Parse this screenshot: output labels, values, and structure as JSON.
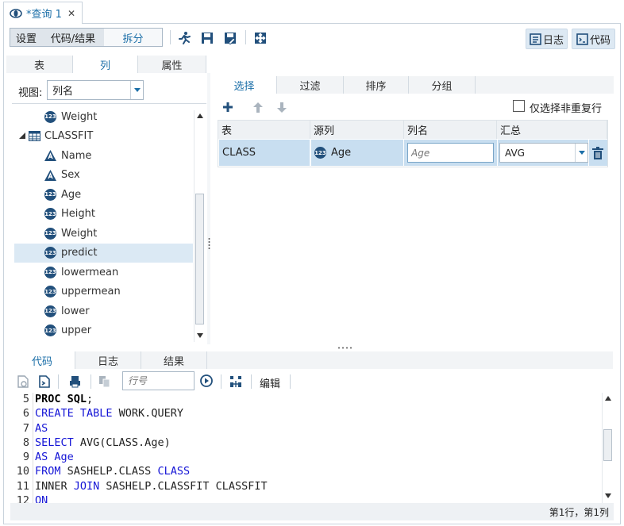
{
  "document_tab": {
    "title": "*查询 1",
    "close": "✕"
  },
  "toolbar": {
    "segments": [
      "设置",
      "代码/结果",
      "拆分"
    ],
    "log_button": "日志",
    "code_button": "代码"
  },
  "left_tabs": [
    "表",
    "列",
    "属性"
  ],
  "view": {
    "label": "视图:",
    "value": "列名"
  },
  "tree": {
    "items": [
      {
        "label": "Weight",
        "type": "numeric"
      },
      {
        "label": "CLASSFIT",
        "type": "table"
      },
      {
        "label": "Name",
        "type": "char"
      },
      {
        "label": "Sex",
        "type": "char"
      },
      {
        "label": "Age",
        "type": "numeric"
      },
      {
        "label": "Height",
        "type": "numeric"
      },
      {
        "label": "Weight",
        "type": "numeric"
      },
      {
        "label": "predict",
        "type": "numeric",
        "selected": true
      },
      {
        "label": "lowermean",
        "type": "numeric"
      },
      {
        "label": "uppermean",
        "type": "numeric"
      },
      {
        "label": "lower",
        "type": "numeric"
      },
      {
        "label": "upper",
        "type": "numeric"
      }
    ]
  },
  "right_tabs": [
    "选择",
    "过滤",
    "排序",
    "分组"
  ],
  "distinct_label": "仅选择非重复行",
  "grid": {
    "headers": [
      "表",
      "源列",
      "列名",
      "汇总"
    ],
    "row": {
      "table": "CLASS",
      "source": "Age",
      "name_placeholder": "Age",
      "summary": "AVG"
    }
  },
  "bottom_tabs": [
    "代码",
    "日志",
    "结果"
  ],
  "code_toolbar": {
    "line_placeholder": "行号",
    "edit_label": "编辑"
  },
  "code_lines": [
    {
      "n": "5",
      "parts": [
        [
          "kwb",
          "PROC SQL"
        ],
        [
          "",
          ";"
        ]
      ]
    },
    {
      "n": "6",
      "parts": [
        [
          "kw",
          "CREATE TABLE"
        ],
        [
          "",
          " WORK.QUERY"
        ]
      ]
    },
    {
      "n": "7",
      "parts": [
        [
          "kw",
          "AS"
        ]
      ]
    },
    {
      "n": "8",
      "parts": [
        [
          "kw",
          "SELECT"
        ],
        [
          "",
          " AVG(CLASS.Age)"
        ]
      ]
    },
    {
      "n": "9",
      "parts": [
        [
          "kw",
          "AS Age"
        ]
      ]
    },
    {
      "n": "10",
      "parts": [
        [
          "kw",
          "FROM"
        ],
        [
          "",
          " SASHELP.CLASS "
        ],
        [
          "kw",
          "CLASS"
        ]
      ]
    },
    {
      "n": "11",
      "parts": [
        [
          "",
          "INNER "
        ],
        [
          "kw",
          "JOIN"
        ],
        [
          "",
          " SASHELP.CLASSFIT CLASSFIT"
        ]
      ]
    },
    {
      "n": "12",
      "parts": [
        [
          "kw",
          "ON"
        ]
      ]
    }
  ],
  "status": "第1行，第1列",
  "colors": {
    "accent": "#1c6fa8",
    "selected_row": "#dbe9f4",
    "grid_cell": "#c8def0",
    "keyword": "#1515d6"
  }
}
